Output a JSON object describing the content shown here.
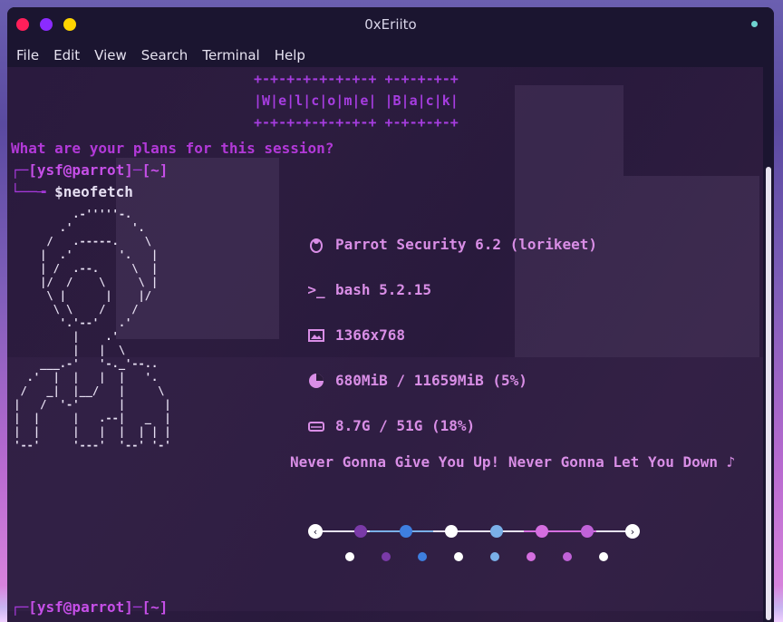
{
  "window": {
    "title": "0xEriito"
  },
  "menu": [
    "File",
    "Edit",
    "View",
    "Search",
    "Terminal",
    "Help"
  ],
  "terminal": {
    "banner_top": "+-+-+-+-+-+-+-+ +-+-+-+-+",
    "banner_mid": "|W|e|l|c|o|m|e| |B|a|c|k|",
    "banner_bot": "+-+-+-+-+-+-+-+ +-+-+-+-+",
    "question": "What are your plans for this session?",
    "prompt1_user": "[ysf@parrot]",
    "prompt1_dir": "[~]",
    "prompt1_cmd": "$neofetch",
    "prompt2_user": "[ysf@parrot]",
    "prompt2_dir": "[~]"
  },
  "neofetch": {
    "os": "Parrot Security 6.2 (lorikeet)",
    "shell": "bash 5.2.15",
    "resolution": "1366x768",
    "memory": "680MiB / 11659MiB (5%)",
    "disk": "8.7G / 51G (18%)",
    "song": "Never Gonna Give You Up! Never Gonna Let You Down ♪"
  },
  "icons": [
    "linux-penguin-icon",
    "terminal-prompt-icon",
    "image-icon",
    "pie-chart-icon",
    "drive-icon"
  ],
  "colors": {
    "accent": "#b239d8",
    "info": "#d98ee6",
    "red_dot": "#ff1f5a",
    "purple_dot": "#8b2bff",
    "yellow_dot": "#ffd400"
  },
  "palette_dots": [
    "#ffffff",
    "#7a3aa8",
    "#3e7fe0",
    "#ffffff",
    "#7ab0e8",
    "#d56ee0",
    "#c062d8",
    "#ffffff"
  ]
}
